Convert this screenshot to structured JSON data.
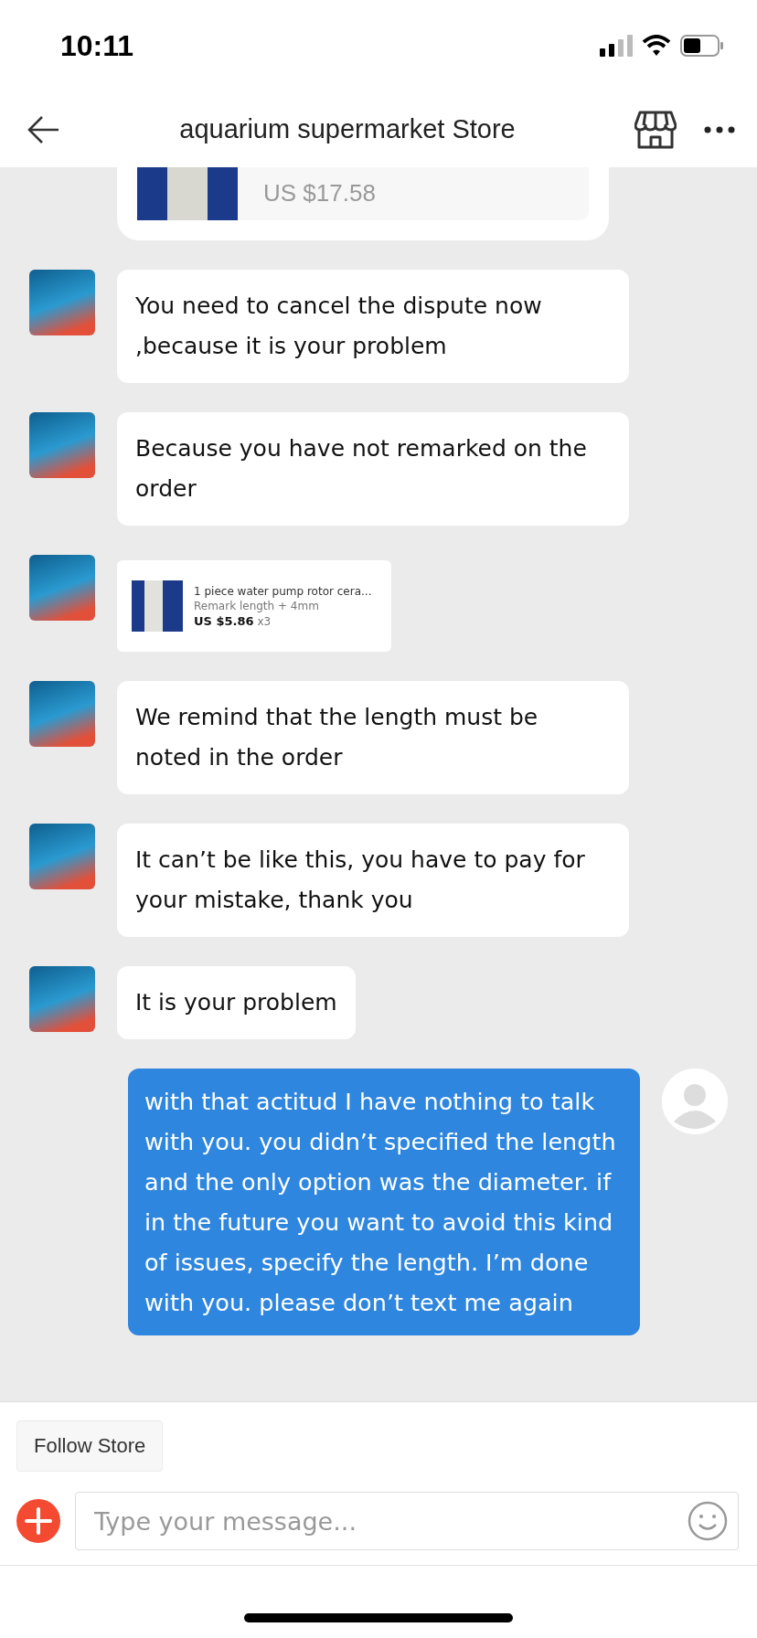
{
  "status_bar": {
    "time": "10:11"
  },
  "header": {
    "title": "aquarium supermarket Store"
  },
  "messages": [
    {
      "kind": "order_card",
      "price": "US $17.58"
    },
    {
      "kind": "text",
      "outgoing": false,
      "text": "You need to cancel the dispute now ,because it is your problem"
    },
    {
      "kind": "text",
      "outgoing": false,
      "text": "Because you have not remarked on the order"
    },
    {
      "kind": "product",
      "outgoing": false,
      "title": "1 piece water pump rotor cera...",
      "remark": "Remark length + 4mm",
      "price": "US $5.86",
      "quantity": "x3"
    },
    {
      "kind": "text",
      "outgoing": false,
      "text": "We remind that the length must be noted in the order"
    },
    {
      "kind": "text",
      "outgoing": false,
      "text": "It can’t be like this, you have to pay for your mistake, thank you"
    },
    {
      "kind": "text",
      "outgoing": false,
      "text": "It is your problem"
    },
    {
      "kind": "text",
      "outgoing": true,
      "text": "with that actitud I have nothing to talk with you. you didn’t specified the length and the only option was the diameter. if in the future you want to avoid this kind of issues, specify the length. I’m done with you. please don’t text me again"
    }
  ],
  "follow_button": "Follow Store",
  "composer": {
    "placeholder": "Type your message..."
  }
}
